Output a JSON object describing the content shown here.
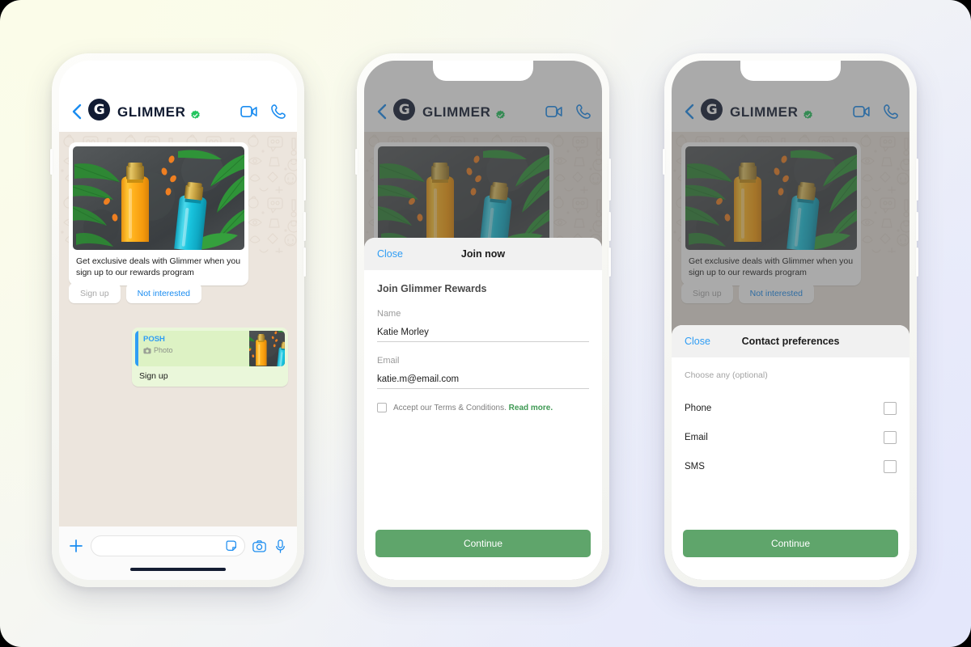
{
  "background": {
    "top_left": "#fafce9",
    "bottom_right": "#e7eafb"
  },
  "chat": {
    "back_icon": "chevron-left-icon",
    "logo_letter": "G",
    "brand": "GLIMMER",
    "verified_icon": "verified-badge-icon",
    "video_icon": "video-call-icon",
    "call_icon": "phone-call-icon",
    "card": {
      "image_alt": "shampoo-bottles-product-photo",
      "text": "Get exclusive deals with Glimmer when you sign up to our rewards program",
      "buttons": [
        {
          "label": "Sign up",
          "state": "disabled"
        },
        {
          "label": "Not interested",
          "state": "link"
        }
      ]
    },
    "reply": {
      "quote_title": "POSH",
      "quote_icon": "camera-icon",
      "quote_subtitle": "Photo",
      "message": "Sign up"
    },
    "input_bar": {
      "plus_icon": "plus-icon",
      "placeholder": "",
      "sticker_icon": "sticker-icon",
      "camera_icon": "camera-icon",
      "mic_icon": "microphone-icon"
    }
  },
  "join_sheet": {
    "close_label": "Close",
    "title": "Join now",
    "form_title": "Join Glimmer Rewards",
    "fields": [
      {
        "label": "Name",
        "value": "Katie Morley"
      },
      {
        "label": "Email",
        "value": "katie.m@email.com"
      }
    ],
    "terms_text": "Accept our Terms & Conditions.",
    "terms_link": "Read more.",
    "terms_checked": false,
    "submit_label": "Continue"
  },
  "prefs_sheet": {
    "close_label": "Close",
    "title": "Contact preferences",
    "hint": "Choose any (optional)",
    "options": [
      {
        "label": "Phone",
        "checked": false
      },
      {
        "label": "Email",
        "checked": false
      },
      {
        "label": "SMS",
        "checked": false
      }
    ],
    "submit_label": "Continue"
  },
  "colors": {
    "accent_blue": "#2f9df4",
    "green_button": "#5fa56b",
    "terms_link_green": "#3f9a54",
    "brand_dark": "#111b33",
    "chat_bg": "#ece5dd",
    "reply_bubble": "#eaf7da"
  }
}
